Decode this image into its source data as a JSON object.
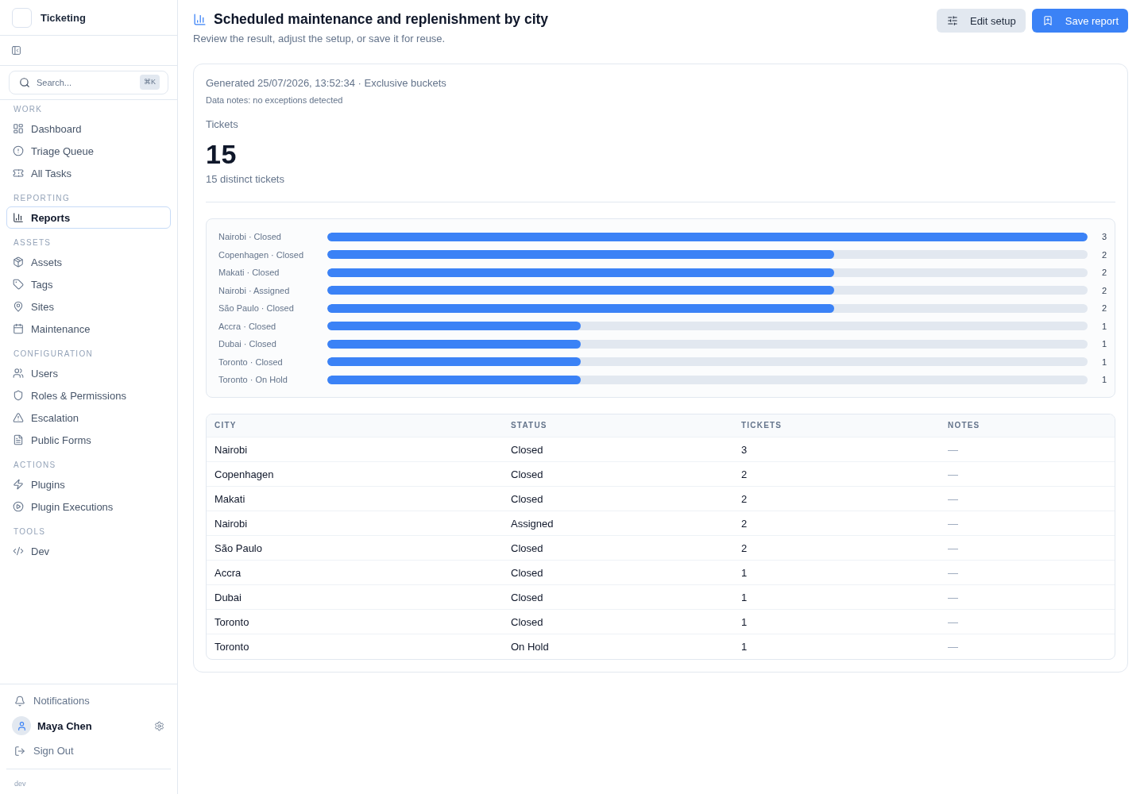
{
  "sidebar": {
    "brand": "Ticketing",
    "search": {
      "placeholder": "Search...",
      "shortcut": "⌘K"
    },
    "sections": [
      {
        "title": "WORK",
        "items": [
          {
            "label": "Dashboard",
            "selected": false
          },
          {
            "label": "Triage Queue",
            "selected": false
          },
          {
            "label": "All Tasks",
            "selected": false
          }
        ]
      },
      {
        "title": "REPORTING",
        "items": [
          {
            "label": "Reports",
            "selected": true
          }
        ]
      },
      {
        "title": "ASSETS",
        "items": [
          {
            "label": "Assets",
            "selected": false
          },
          {
            "label": "Tags",
            "selected": false
          },
          {
            "label": "Sites",
            "selected": false
          },
          {
            "label": "Maintenance",
            "selected": false
          }
        ]
      },
      {
        "title": "CONFIGURATION",
        "items": [
          {
            "label": "Users",
            "selected": false
          },
          {
            "label": "Roles & Permissions",
            "selected": false
          },
          {
            "label": "Escalation",
            "selected": false
          },
          {
            "label": "Public Forms",
            "selected": false
          }
        ]
      },
      {
        "title": "ACTIONS",
        "items": [
          {
            "label": "Plugins",
            "selected": false
          },
          {
            "label": "Plugin Executions",
            "selected": false
          }
        ]
      },
      {
        "title": "TOOLS",
        "items": [
          {
            "label": "Dev",
            "selected": false
          }
        ]
      }
    ],
    "footer": {
      "notifications": "Notifications",
      "user": "Maya Chen",
      "sign_out": "Sign Out",
      "environment": "dev"
    }
  },
  "header": {
    "title": "Scheduled maintenance and replenishment by city",
    "subtitle": "Review the result, adjust the setup, or save it for reuse.",
    "buttons": [
      {
        "label": "Edit setup",
        "kind": "secondary"
      },
      {
        "label": "Save report",
        "kind": "primary"
      }
    ]
  },
  "report": {
    "generated": "Generated 25/07/2026, 13:52:34 · Exclusive buckets",
    "notes": "Data notes: no exceptions detected",
    "metric": {
      "label": "Tickets",
      "value": "15",
      "caption": "15 distinct tickets"
    },
    "bars": [
      {
        "label": "Nairobi · Closed",
        "level": 1,
        "value": "3"
      },
      {
        "label": "Copenhagen · Closed",
        "level": 0.6667,
        "value": "2"
      },
      {
        "label": "Makati · Closed",
        "level": 0.6667,
        "value": "2"
      },
      {
        "label": "Nairobi · Assigned",
        "level": 0.6667,
        "value": "2"
      },
      {
        "label": "São Paulo · Closed",
        "level": 0.6667,
        "value": "2"
      },
      {
        "label": "Accra · Closed",
        "level": 0.3333,
        "value": "1"
      },
      {
        "label": "Dubai · Closed",
        "level": 0.3333,
        "value": "1"
      },
      {
        "label": "Toronto · Closed",
        "level": 0.3333,
        "value": "1"
      },
      {
        "label": "Toronto · On Hold",
        "level": 0.3333,
        "value": "1"
      }
    ],
    "table": {
      "columns": [
        "CITY",
        "STATUS",
        "TICKETS",
        "NOTES"
      ],
      "rows": [
        [
          "Nairobi",
          "Closed",
          "3",
          "—"
        ],
        [
          "Copenhagen",
          "Closed",
          "2",
          "—"
        ],
        [
          "Makati",
          "Closed",
          "2",
          "—"
        ],
        [
          "Nairobi",
          "Assigned",
          "2",
          "—"
        ],
        [
          "São Paulo",
          "Closed",
          "2",
          "—"
        ],
        [
          "Accra",
          "Closed",
          "1",
          "—"
        ],
        [
          "Dubai",
          "Closed",
          "1",
          "—"
        ],
        [
          "Toronto",
          "Closed",
          "1",
          "—"
        ],
        [
          "Toronto",
          "On Hold",
          "1",
          "—"
        ]
      ]
    }
  }
}
